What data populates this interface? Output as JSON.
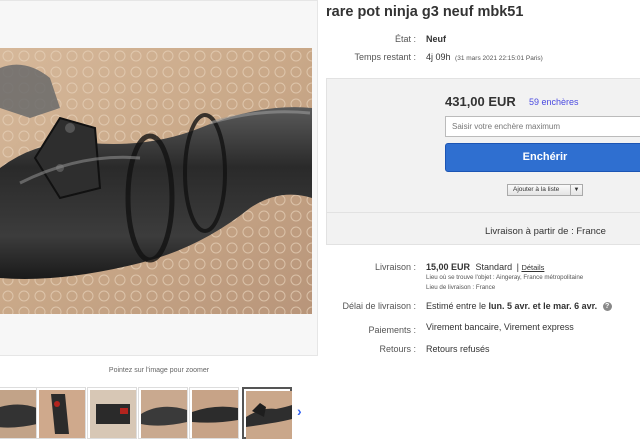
{
  "listing": {
    "title": "rare pot ninja g3 neuf mbk51"
  },
  "details": {
    "condition_label": "État :",
    "condition_value": "Neuf",
    "time_label": "Temps restant :",
    "time_value": "4j 09h",
    "time_detail": "(31 mars 2021   22:15:01 Paris)"
  },
  "bid": {
    "price": "431,00 EUR",
    "bids_count": "59 enchères",
    "input_placeholder": "Saisir votre enchère maximum",
    "bid_button": "Enchérir",
    "watch_button": "Ajouter à la liste",
    "ship_from": "Livraison à partir de : France"
  },
  "shipping": {
    "label": "Livraison :",
    "price": "15,00 EUR",
    "method": "Standard",
    "details_link": "Détails",
    "item_location": "Lieu où se trouve l'objet : Aingeray, France métropolitaine",
    "ships_to": "Lieu de livraison : France"
  },
  "delivery": {
    "label": "Délai de livraison :",
    "prefix": "Estimé entre le",
    "range": "lun. 5 avr. et le mar. 6 avr."
  },
  "payments": {
    "label": "Paiements :",
    "value": "Virement bancaire, Virement express"
  },
  "returns": {
    "label": "Retours :",
    "value": "Retours refusés"
  },
  "gallery": {
    "zoom_hint": "Pointez sur l'image pour zoomer",
    "thumb_count": 6,
    "selected_index": 5
  },
  "colors": {
    "bid_button": "#2f6fd0",
    "bids_link": "#4a4ae0",
    "thumb_next": "#3665f3"
  }
}
